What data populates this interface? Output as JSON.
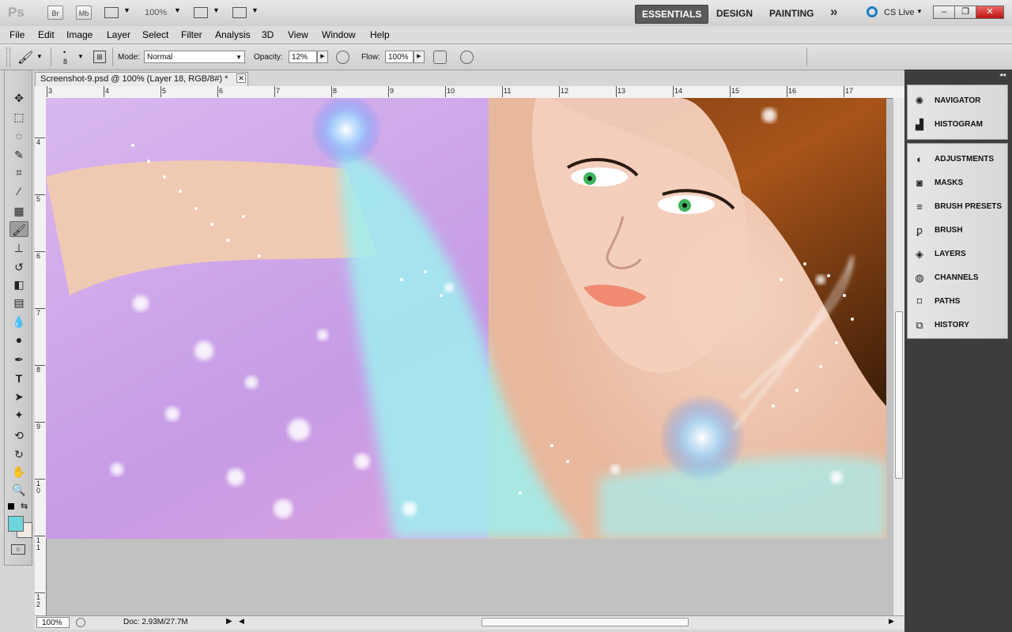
{
  "app": {
    "logo": "Ps",
    "bridge_label": "Br",
    "minibridge_label": "Mb",
    "zoom": "100%",
    "workspaces": [
      "ESSENTIALS",
      "DESIGN",
      "PAINTING"
    ],
    "active_workspace": "ESSENTIALS",
    "more_glyph": "»",
    "cs_live": "CS Live"
  },
  "menu": [
    "File",
    "Edit",
    "Image",
    "Layer",
    "Select",
    "Filter",
    "Analysis",
    "3D",
    "View",
    "Window",
    "Help"
  ],
  "options": {
    "brush_size": "8",
    "mode_label": "Mode:",
    "mode_value": "Normal",
    "opacity_label": "Opacity:",
    "opacity_value": "12%",
    "flow_label": "Flow:",
    "flow_value": "100%"
  },
  "document": {
    "tab_title": "Screenshot-9.psd @ 100% (Layer 18, RGB/8#) *",
    "ruler_h": [
      "3",
      "4",
      "5",
      "6",
      "7",
      "8",
      "9",
      "10",
      "11",
      "12",
      "13",
      "14",
      "15",
      "16",
      "17"
    ],
    "ruler_v": [
      "4",
      "5",
      "6",
      "7",
      "8",
      "9",
      "1 0",
      "1 1",
      "1 2"
    ]
  },
  "status": {
    "zoom": "100%",
    "doc": "Doc: 2.93M/27.7M"
  },
  "panels": {
    "group1": [
      {
        "label": "NAVIGATOR",
        "icon": "navigator-icon"
      },
      {
        "label": "HISTOGRAM",
        "icon": "histogram-icon"
      }
    ],
    "group2": [
      {
        "label": "ADJUSTMENTS",
        "icon": "adjustments-icon"
      },
      {
        "label": "MASKS",
        "icon": "masks-icon"
      },
      {
        "label": "BRUSH PRESETS",
        "icon": "brush-presets-icon"
      },
      {
        "label": "BRUSH",
        "icon": "brush-icon"
      },
      {
        "label": "LAYERS",
        "icon": "layers-icon"
      },
      {
        "label": "CHANNELS",
        "icon": "channels-icon"
      },
      {
        "label": "PATHS",
        "icon": "paths-icon"
      },
      {
        "label": "HISTORY",
        "icon": "history-icon"
      }
    ]
  },
  "colors": {
    "foreground": "#6fd3dc",
    "background": "#f3ebe3"
  }
}
